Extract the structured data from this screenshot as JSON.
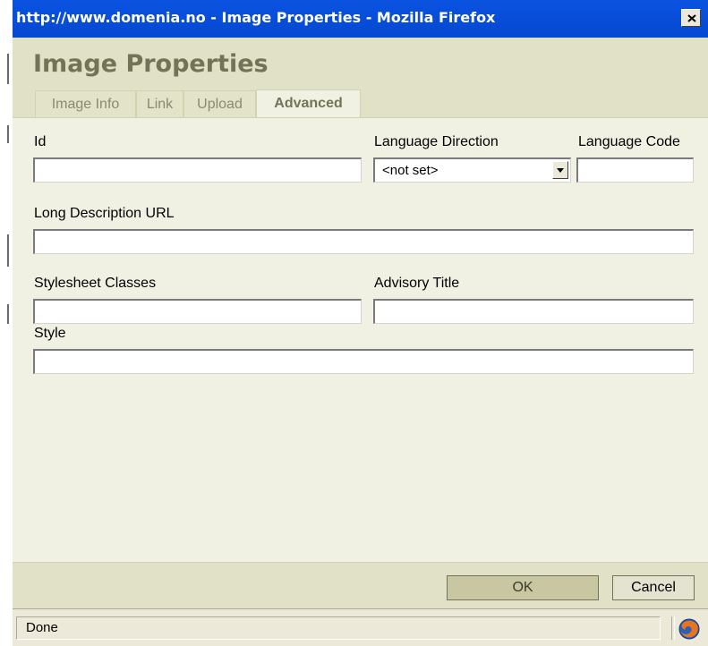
{
  "window": {
    "title": "http://www.domenia.no - Image Properties - Mozilla Firefox",
    "close_icon": "close-icon"
  },
  "dialog": {
    "title": "Image Properties",
    "tabs": [
      {
        "label": "Image Info",
        "active": false
      },
      {
        "label": "Link",
        "active": false
      },
      {
        "label": "Upload",
        "active": false
      },
      {
        "label": "Advanced",
        "active": true
      }
    ]
  },
  "form": {
    "id": {
      "label": "Id",
      "value": ""
    },
    "language_direction": {
      "label": "Language Direction",
      "value": "<not set>"
    },
    "language_code": {
      "label": "Language Code",
      "value": ""
    },
    "long_description_url": {
      "label": "Long Description URL",
      "value": ""
    },
    "stylesheet_classes": {
      "label": "Stylesheet Classes",
      "value": ""
    },
    "advisory_title": {
      "label": "Advisory Title",
      "value": ""
    },
    "style": {
      "label": "Style",
      "value": ""
    }
  },
  "buttons": {
    "ok": "OK",
    "cancel": "Cancel"
  },
  "status": {
    "text": "Done",
    "icon": "firefox-icon"
  },
  "colors": {
    "titlebar": "#0a53e0",
    "dialog_header": "#e1e1c7",
    "panel": "#f1f1e3",
    "title_text": "#737357"
  }
}
